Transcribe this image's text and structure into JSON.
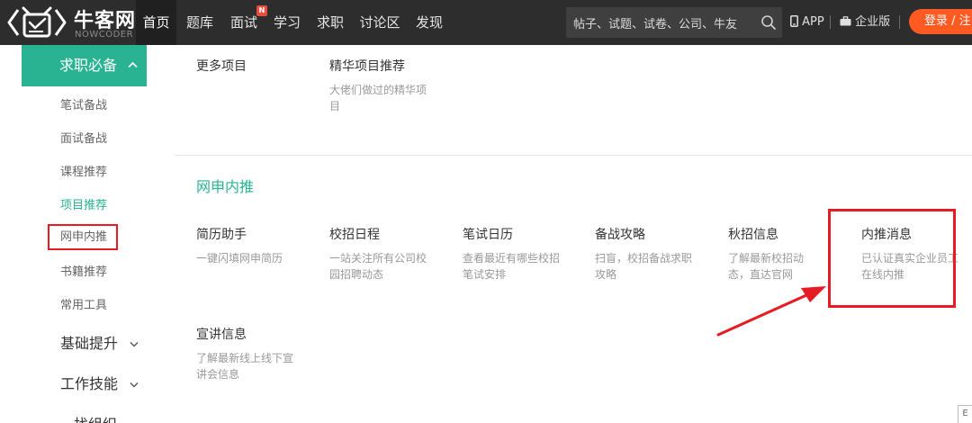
{
  "colors": {
    "topbar": "#2d2d2d",
    "accent_green": "#29b392",
    "login_orange": "#ff5a22",
    "highlight_red": "#e51c23"
  },
  "header": {
    "logo_icon": "nowcoder-logo-icon",
    "logo_text": "牛客网",
    "logo_subtext": "NOWCODER",
    "nav": [
      {
        "label": "首页",
        "active": true
      },
      {
        "label": "题库"
      },
      {
        "label": "面试",
        "badge": "N"
      },
      {
        "label": "学习"
      },
      {
        "label": "求职"
      },
      {
        "label": "讨论区"
      },
      {
        "label": "发现"
      }
    ],
    "search": {
      "placeholder": "帖子、试题、试卷、公司、牛友",
      "icon": "search-icon"
    },
    "app_link": {
      "icon": "phone-icon",
      "label": "APP"
    },
    "enterprise_link": {
      "icon": "briefcase-icon",
      "label": "企业版"
    },
    "login_label": "登录 / 注"
  },
  "sidebar": {
    "header": {
      "label": "求职必备",
      "icon": "chevron-up-icon"
    },
    "items": [
      {
        "label": "笔试备战"
      },
      {
        "label": "面试备战"
      },
      {
        "label": "课程推荐"
      },
      {
        "label": "项目推荐",
        "current": true
      },
      {
        "label": "网申内推",
        "boxed": true
      },
      {
        "label": "书籍推荐"
      },
      {
        "label": "常用工具"
      }
    ],
    "groups": [
      {
        "label": "基础提升",
        "icon": "chevron-down-icon"
      },
      {
        "label": "工作技能",
        "icon": "chevron-down-icon"
      },
      {
        "label": "找组织",
        "icon": "chevron-down-icon"
      }
    ]
  },
  "main": {
    "top_cards": [
      {
        "title": "更多项目",
        "desc": ""
      },
      {
        "title": "精华项目推荐",
        "desc": "大佬们做过的精华项目"
      }
    ],
    "section_title": "网申内推",
    "cards": [
      {
        "title": "简历助手",
        "desc": "一键闪填网申简历"
      },
      {
        "title": "校招日程",
        "desc": "一站关注所有公司校园招聘动态"
      },
      {
        "title": "笔试日历",
        "desc": "查看最近有哪些校招笔试安排"
      },
      {
        "title": "备战攻略",
        "desc": "扫盲，校招备战求职攻略"
      },
      {
        "title": "秋招信息",
        "desc": "了解最新校招动态，直达官网"
      },
      {
        "title": "内推消息",
        "desc": "已认证真实企业员工在线内推"
      },
      {
        "title": "宣讲信息",
        "desc": "了解最新线上线下宣讲会信息"
      }
    ],
    "corner_widget": "E"
  }
}
